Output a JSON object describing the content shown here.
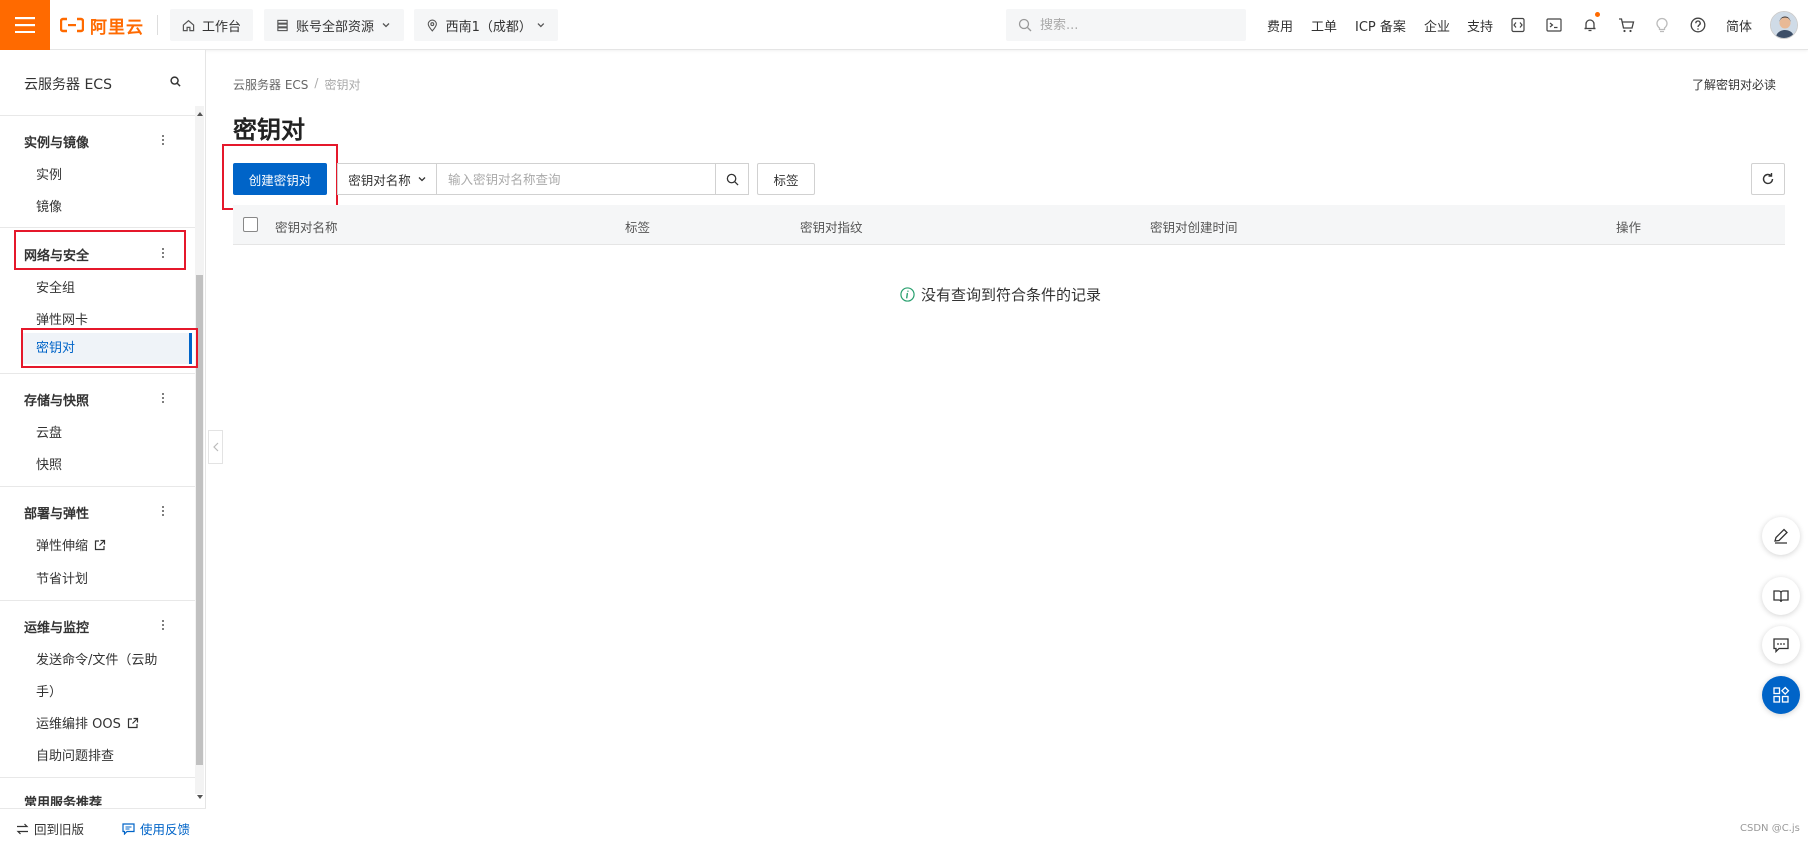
{
  "topbar": {
    "logo_text": "阿里云",
    "workbench": "工作台",
    "account_scope": "账号全部资源",
    "region": "西南1（成都）",
    "search_placeholder": "搜索...",
    "links": [
      "费用",
      "工单",
      "ICP 备案",
      "企业",
      "支持"
    ],
    "language": "简体",
    "icons": [
      "code-icon",
      "terminal-icon",
      "bell-icon",
      "cart-icon",
      "bulb-icon",
      "help-icon"
    ]
  },
  "sidebar": {
    "title": "云服务器 ECS",
    "groups": [
      {
        "label": "实例与镜像",
        "items": [
          "实例",
          "镜像"
        ]
      },
      {
        "label": "网络与安全",
        "items": [
          "安全组",
          "弹性网卡",
          "密钥对"
        ]
      },
      {
        "label": "存储与快照",
        "items": [
          "云盘",
          "快照"
        ]
      },
      {
        "label": "部署与弹性",
        "items": [
          "弹性伸缩",
          "节省计划"
        ]
      },
      {
        "label": "运维与监控",
        "items": [
          "发送命令/文件（云助",
          "手）",
          "运维编排 OOS",
          "自助问题排查"
        ]
      },
      {
        "label": "常用服务推荐"
      }
    ],
    "active_item": "密钥对",
    "footer_back": "回到旧版",
    "footer_feedback": "使用反馈"
  },
  "main": {
    "breadcrumb": [
      "云服务器 ECS",
      "/",
      "密钥对"
    ],
    "help_link": "了解密钥对必读",
    "title": "密钥对",
    "create_button": "创建密钥对",
    "filter_select": "密钥对名称",
    "filter_placeholder": "输入密钥对名称查询",
    "tag_button": "标签",
    "columns": [
      "密钥对名称",
      "标签",
      "密钥对指纹",
      "密钥对创建时间",
      "操作"
    ],
    "empty_message": "没有查询到符合条件的记录"
  },
  "watermark": "CSDN @C.js",
  "colors": {
    "brand": "#ff6a00",
    "primary": "#0064c8",
    "highlight": "#e5182b"
  }
}
